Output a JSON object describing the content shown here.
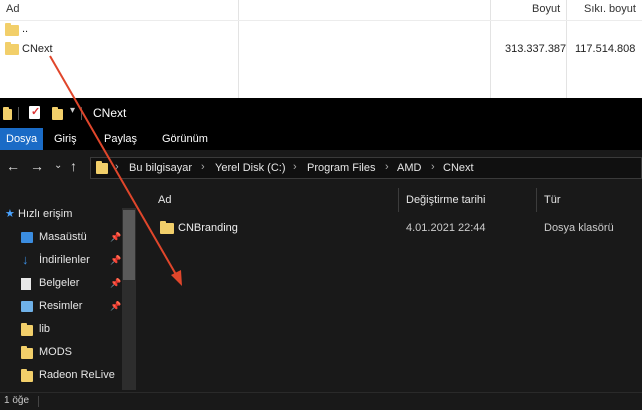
{
  "archive": {
    "columns": {
      "name": "Ad",
      "size": "Boyut",
      "packed": "Sıkı. boyut"
    },
    "rows": [
      {
        "name": "..",
        "size": "",
        "packed": ""
      },
      {
        "name": "CNext",
        "size": "313.337.387",
        "packed": "117.514.808"
      }
    ]
  },
  "explorer": {
    "window_title": "CNext",
    "ribbon_tabs": [
      "Dosya",
      "Giriş",
      "Paylaş",
      "Görünüm"
    ],
    "active_tab": "Dosya",
    "breadcrumb": [
      "Bu bilgisayar",
      "Yerel Disk (C:)",
      "Program Files",
      "AMD",
      "CNext"
    ],
    "sidebar": {
      "quick_access": "Hızlı erişim",
      "items": [
        {
          "label": "Masaüstü",
          "icon": "desktop-icon",
          "pinned": true
        },
        {
          "label": "İndirilenler",
          "icon": "download-icon",
          "pinned": true
        },
        {
          "label": "Belgeler",
          "icon": "document-icon",
          "pinned": true
        },
        {
          "label": "Resimler",
          "icon": "pictures-icon",
          "pinned": true
        },
        {
          "label": "lib",
          "icon": "folder-icon",
          "pinned": false
        },
        {
          "label": "MODS",
          "icon": "folder-icon",
          "pinned": false
        },
        {
          "label": "Radeon ReLive",
          "icon": "folder-icon",
          "pinned": false
        }
      ]
    },
    "columns": {
      "name": "Ad",
      "modified": "Değiştirme tarihi",
      "type": "Tür"
    },
    "files": [
      {
        "name": "CNBranding",
        "modified": "4.01.2021 22:44",
        "type": "Dosya klasörü"
      }
    ],
    "status": "1 öğe"
  },
  "colors": {
    "accent": "#1a6bc6",
    "folder": "#f2cf6a",
    "arrow": "#e0462b"
  }
}
